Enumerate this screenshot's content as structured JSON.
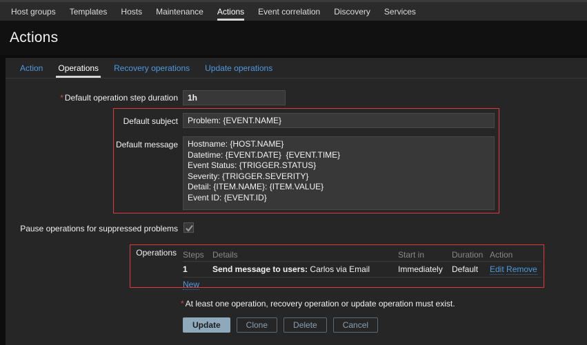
{
  "topmenu": {
    "items": [
      {
        "label": "Host groups",
        "active": false
      },
      {
        "label": "Templates",
        "active": false
      },
      {
        "label": "Hosts",
        "active": false
      },
      {
        "label": "Maintenance",
        "active": false
      },
      {
        "label": "Actions",
        "active": true
      },
      {
        "label": "Event correlation",
        "active": false
      },
      {
        "label": "Discovery",
        "active": false
      },
      {
        "label": "Services",
        "active": false
      }
    ]
  },
  "page": {
    "title": "Actions"
  },
  "tabs": [
    {
      "label": "Action",
      "active": false
    },
    {
      "label": "Operations",
      "active": true
    },
    {
      "label": "Recovery operations",
      "active": false
    },
    {
      "label": "Update operations",
      "active": false
    }
  ],
  "form": {
    "step_duration": {
      "label": "Default operation step duration",
      "required": "*",
      "value": "1h"
    },
    "default_subject": {
      "label": "Default subject",
      "value": "Problem: {EVENT.NAME}"
    },
    "default_message": {
      "label": "Default message",
      "value": "Hostname: {HOST.NAME}\nDatetime: {EVENT.DATE}  {EVENT.TIME}\nEvent Status: {TRIGGER.STATUS}\nSeverity: {TRIGGER.SEVERITY}\nDetail: {ITEM.NAME}: {ITEM.VALUE}\nEvent ID: {EVENT.ID}"
    },
    "pause_suppressed": {
      "label": "Pause operations for suppressed problems",
      "checked": true
    },
    "operations": {
      "label": "Operations",
      "columns": [
        "Steps",
        "Details",
        "Start in",
        "Duration",
        "Action"
      ],
      "rows": [
        {
          "steps": "1",
          "details_bold": "Send message to users:",
          "details_rest": " Carlos via Email",
          "start_in": "Immediately",
          "duration": "Default",
          "edit_label": "Edit",
          "remove_label": "Remove"
        }
      ],
      "new_label": "New"
    }
  },
  "footer": {
    "hint_marker": "*",
    "hint": "At least one operation, recovery operation or update operation must exist.",
    "buttons": [
      {
        "label": "Update",
        "style": "primary"
      },
      {
        "label": "Clone",
        "style": "ghost"
      },
      {
        "label": "Delete",
        "style": "ghost"
      },
      {
        "label": "Cancel",
        "style": "ghost"
      }
    ]
  },
  "colors": {
    "accent_link": "#4f9ae0",
    "highlight_border": "#e0383e",
    "primary_button": "#8fa9bc",
    "required_marker": "#c0504d"
  }
}
